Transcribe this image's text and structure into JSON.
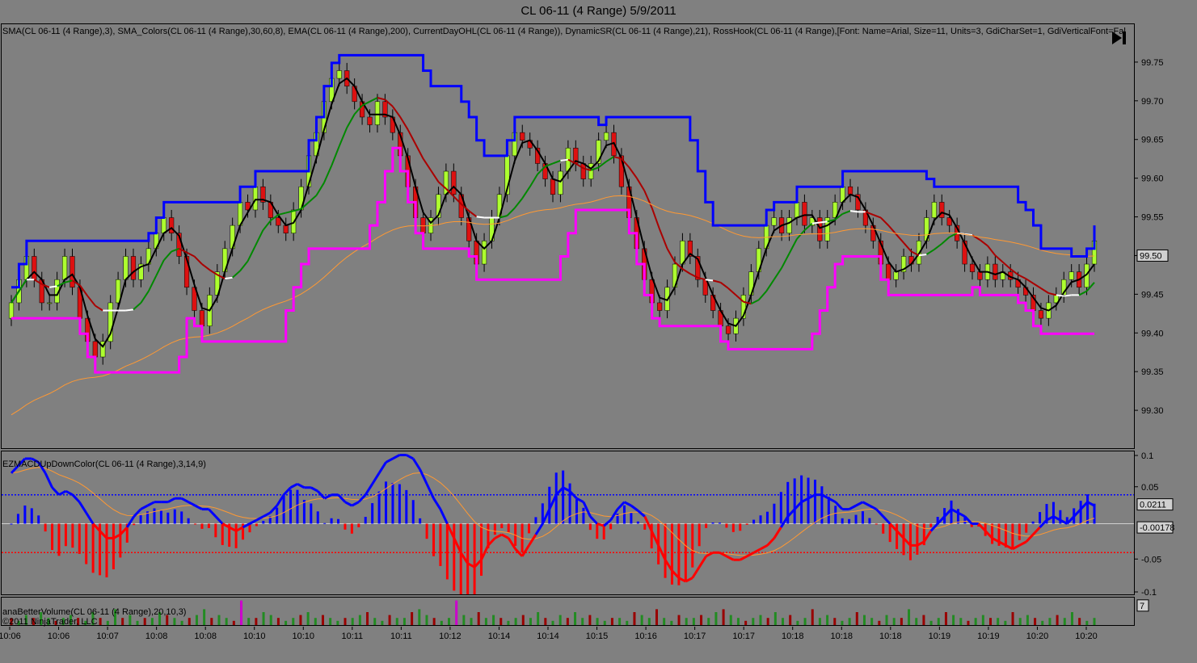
{
  "window": {
    "title": "CL 06-11 (4 Range)  5/9/2011"
  },
  "indicators": {
    "price_label": "SMA(CL 06-11 (4 Range),3), SMA_Colors(CL 06-11 (4 Range),30,60,8), EMA(CL 06-11 (4 Range),200), CurrentDayOHL(CL 06-11 (4 Range)), DynamicSR(CL 06-11 (4 Range),21), RossHook(CL 06-11 (4 Range),[Font: Name=Arial, Size=11, Units=3, GdiCharSet=1, GdiVerticalFont=Fal",
    "macd_label": "EZMACDUpDownColor(CL 06-11 (4 Range),3,14,9)",
    "volume_label": "anaBetterVolume(CL 06-11 (4 Range),20,10,3)",
    "copyright": "©2011 NinjaTrader, LLC"
  },
  "colors": {
    "background": "#808080",
    "up_bar": "#adff2f",
    "down_bar": "#dd1111",
    "resistance": "#0000ff",
    "support": "#ff00ff",
    "ema": "#ff9933",
    "macd_up": "#0000ff",
    "macd_down": "#ff0000"
  },
  "icons": {
    "go_end": "skip-to-end-icon"
  },
  "chart_data": [
    {
      "type": "candlestick",
      "name_on_chart": "",
      "ylim": [
        99.25,
        99.8
      ],
      "y_ticks": [
        "99.75",
        "99.70",
        "99.65",
        "99.60",
        "99.55",
        "99.50",
        "99.45",
        "99.40",
        "99.35",
        "99.30"
      ],
      "y_tick_values": [
        99.75,
        99.7,
        99.65,
        99.6,
        99.55,
        99.5,
        99.45,
        99.4,
        99.35,
        99.3
      ],
      "x_ticks": [
        "10:06",
        "10:06",
        "10:07",
        "10:08",
        "10:08",
        "10:10",
        "10:10",
        "10:11",
        "10:11",
        "10:12",
        "10:14",
        "10:14",
        "10:15",
        "10:16",
        "10:17",
        "10:17",
        "10:18",
        "10:18",
        "10:18",
        "10:19",
        "10:19",
        "10:20",
        "10:20"
      ],
      "last_price": "99.50",
      "last_price_value": 99.5,
      "close": [
        99.44,
        99.47,
        99.5,
        99.47,
        99.44,
        99.44,
        99.47,
        99.5,
        99.46,
        99.42,
        99.39,
        99.37,
        99.39,
        99.44,
        99.47,
        99.5,
        99.47,
        99.49,
        99.51,
        99.53,
        99.55,
        99.53,
        99.5,
        99.46,
        99.43,
        99.41,
        99.45,
        99.48,
        99.51,
        99.54,
        99.57,
        99.56,
        99.59,
        99.57,
        99.55,
        99.54,
        99.53,
        99.56,
        99.59,
        99.63,
        99.66,
        99.7,
        99.73,
        99.74,
        99.72,
        99.7,
        99.68,
        99.67,
        99.7,
        99.68,
        99.66,
        99.63,
        99.59,
        99.55,
        99.53,
        99.55,
        99.58,
        99.61,
        99.58,
        99.55,
        99.52,
        99.49,
        99.52,
        99.55,
        99.58,
        99.63,
        99.66,
        99.65,
        99.64,
        99.62,
        99.6,
        99.58,
        99.61,
        99.64,
        99.62,
        99.6,
        99.62,
        99.65,
        99.66,
        99.63,
        99.59,
        99.55,
        99.51,
        99.47,
        99.44,
        99.43,
        99.46,
        99.49,
        99.52,
        99.5,
        99.47,
        99.45,
        99.43,
        99.41,
        99.4,
        99.42,
        99.45,
        99.48,
        99.51,
        99.54,
        99.55,
        99.53,
        99.55,
        99.57,
        99.54,
        99.55,
        99.52,
        99.55,
        99.57,
        99.59,
        99.58,
        99.56,
        99.54,
        99.52,
        99.49,
        99.47,
        99.48,
        99.5,
        99.49,
        99.52,
        99.55,
        99.57,
        99.55,
        99.54,
        99.52,
        99.49,
        99.48,
        99.47,
        99.49,
        99.47,
        99.48,
        99.47,
        99.46,
        99.45,
        99.43,
        99.42,
        99.44,
        99.45,
        99.47,
        99.48,
        99.46,
        99.49,
        99.52
      ]
    },
    {
      "type": "bar",
      "name_on_chart": "",
      "ylim": [
        -0.1,
        0.1
      ],
      "y_ticks": [
        "0.1",
        "0.05",
        "-0.05",
        "-0.1"
      ],
      "y_tick_values": [
        0.1,
        0.05,
        -0.05,
        -0.1
      ],
      "value_tags": [
        "0.0211",
        "-0.00178"
      ],
      "value_tag_values": [
        0.0211,
        -0.00178
      ],
      "levels": [
        0.04,
        -0.04
      ],
      "macd": [
        0.07,
        0.08,
        0.09,
        0.09,
        0.085,
        0.07,
        0.05,
        0.04,
        0.045,
        0.04,
        0.03,
        0.015,
        0.0,
        -0.01,
        -0.02,
        -0.02,
        -0.015,
        -0.005,
        0.01,
        0.02,
        0.025,
        0.03,
        0.03,
        0.03,
        0.035,
        0.035,
        0.03,
        0.025,
        0.02,
        0.02,
        0.01,
        0.0,
        -0.005,
        -0.01,
        -0.005,
        0.0,
        0.005,
        0.01,
        0.015,
        0.025,
        0.04,
        0.05,
        0.055,
        0.05,
        0.05,
        0.045,
        0.035,
        0.04,
        0.04,
        0.03,
        0.025,
        0.03,
        0.04,
        0.055,
        0.07,
        0.085,
        0.09,
        0.095,
        0.095,
        0.09,
        0.075,
        0.055,
        0.035,
        0.02,
        0.0,
        -0.02,
        -0.04,
        -0.055,
        -0.06,
        -0.05,
        -0.03,
        -0.02,
        -0.015,
        -0.02,
        -0.035,
        -0.045,
        -0.03,
        -0.015,
        0.0,
        0.02,
        0.04,
        0.05,
        0.045,
        0.035,
        0.03,
        0.01,
        0.0,
        -0.003,
        0.005,
        0.02,
        0.03,
        0.025,
        0.018,
        0.01,
        -0.01,
        -0.03,
        -0.05,
        -0.065,
        -0.075,
        -0.08,
        -0.075,
        -0.06,
        -0.045,
        -0.04,
        -0.04,
        -0.045,
        -0.05,
        -0.05,
        -0.045,
        -0.04,
        -0.035,
        -0.03,
        -0.02,
        -0.005,
        0.01,
        0.02,
        0.03,
        0.035,
        0.04,
        0.04,
        0.035,
        0.03,
        0.02,
        0.02,
        0.025,
        0.03,
        0.025,
        0.02,
        0.01,
        0.0,
        -0.01,
        -0.02,
        -0.03,
        -0.03,
        -0.025,
        -0.01,
        0.0,
        0.01,
        0.02,
        0.015,
        0.01,
        0.0,
        0.0,
        -0.01,
        -0.02,
        -0.025,
        -0.03,
        -0.035,
        -0.03,
        -0.025,
        -0.015,
        -0.005,
        0.005,
        0.01,
        0.005,
        0.0,
        0.01,
        0.02,
        0.03,
        0.025
      ]
    },
    {
      "type": "bar",
      "name_on_chart": "",
      "ylim": [
        0,
        10
      ],
      "y_ticks": [
        "7"
      ],
      "y_tick_values": [
        7
      ],
      "volume": [
        3,
        2,
        4,
        3,
        5,
        3,
        2,
        3,
        4,
        3,
        2,
        5,
        3,
        2,
        6,
        3,
        4,
        2,
        3,
        3,
        5,
        4,
        3,
        2,
        3,
        4,
        6,
        3,
        4,
        3,
        2,
        9,
        3,
        3,
        5,
        4,
        3,
        2,
        3,
        4,
        5,
        3,
        4,
        3,
        2,
        3,
        3,
        4,
        5,
        3,
        2,
        4,
        3,
        3,
        5,
        6,
        4,
        3,
        2,
        3,
        9,
        4,
        3,
        5,
        3,
        4,
        3,
        2,
        3,
        4,
        3,
        5,
        3,
        2,
        4,
        3,
        5,
        3,
        4,
        3,
        2,
        3,
        3,
        2,
        5,
        4,
        3,
        6,
        3,
        2,
        4,
        3,
        3,
        4,
        3,
        5,
        6,
        4,
        3,
        2,
        3,
        4,
        3,
        5,
        3,
        4,
        2,
        3,
        6,
        3,
        4,
        3,
        2,
        3,
        5,
        4,
        3,
        2,
        4,
        3,
        3,
        6,
        3,
        4,
        2,
        3,
        5,
        4,
        3,
        2,
        3,
        4,
        3,
        3,
        2,
        5,
        3,
        4,
        3,
        2,
        3,
        4,
        3,
        5,
        3,
        2,
        3
      ]
    }
  ]
}
